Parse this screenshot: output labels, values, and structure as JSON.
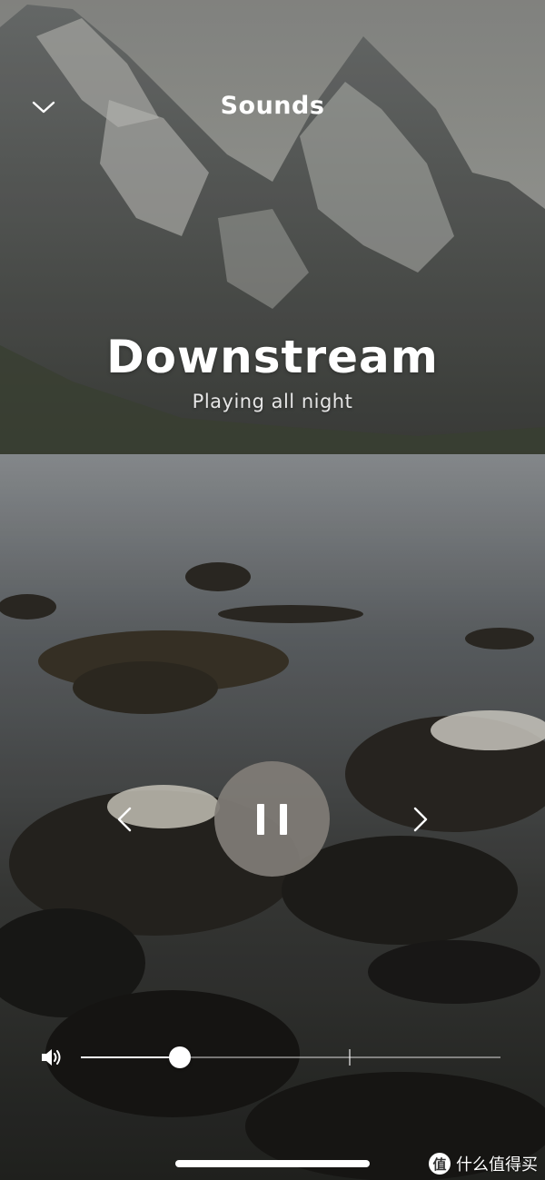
{
  "header": {
    "title": "Sounds",
    "collapse_icon": "chevron-down-icon"
  },
  "now_playing": {
    "title": "Downstream",
    "subtitle": "Playing all night"
  },
  "controls": {
    "previous_icon": "chevron-left-icon",
    "play_pause_icon": "pause-icon",
    "next_icon": "chevron-right-icon"
  },
  "volume": {
    "icon": "speaker-icon",
    "level_fraction": 0.236,
    "marker_fraction": 0.639
  },
  "watermark": {
    "badge": "值",
    "text": "什么值得买"
  },
  "colors": {
    "pause_button": "#807c76",
    "slider_fill": "#ffffff",
    "text": "#ffffff"
  }
}
